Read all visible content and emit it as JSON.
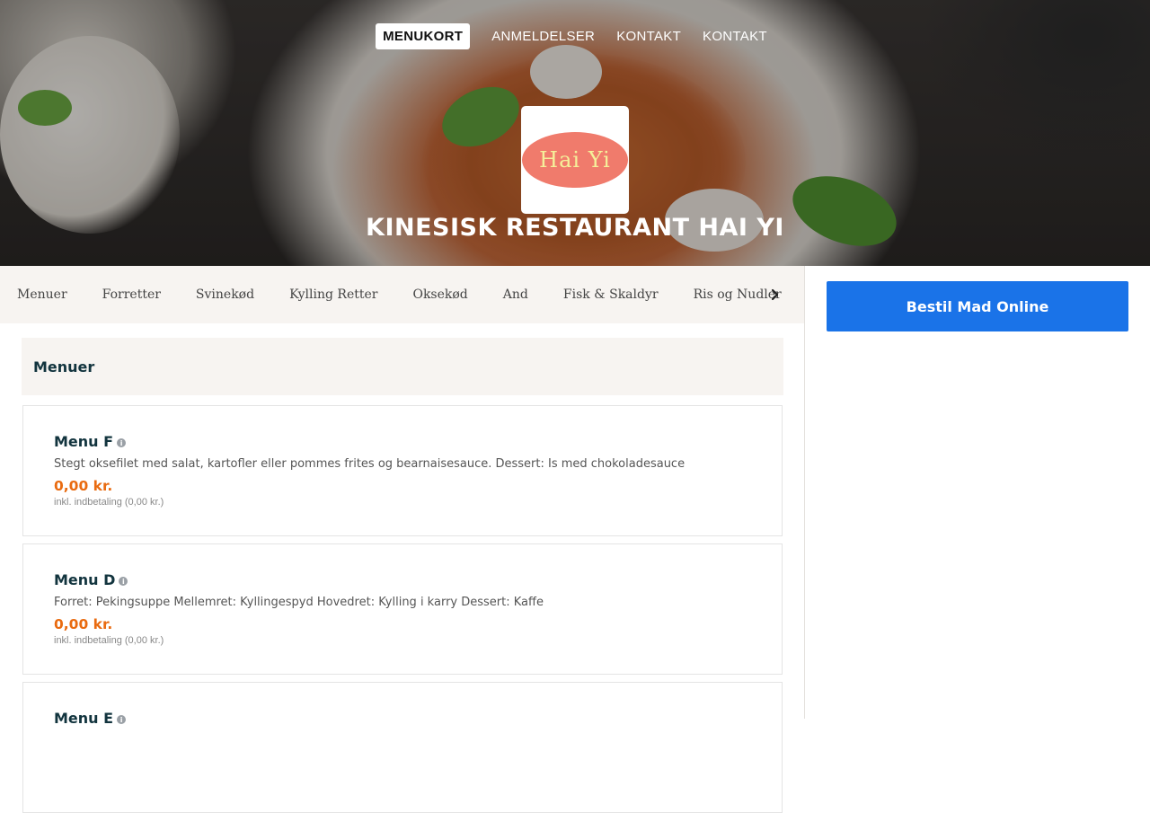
{
  "topnav": {
    "items": [
      {
        "label": "MENUKORT"
      },
      {
        "label": "ANMELDELSER"
      },
      {
        "label": "KONTAKT"
      },
      {
        "label": "KONTAKT"
      }
    ]
  },
  "hero": {
    "logo_text": "Hai Yi",
    "title": "KINESISK RESTAURANT HAI YI"
  },
  "categories": {
    "items": [
      "Menuer",
      "Forretter",
      "Svinekød",
      "Kylling Retter",
      "Oksekød",
      "And",
      "Fisk & Skaldyr",
      "Ris og Nudler"
    ],
    "next_icon": "chevron-right-icon"
  },
  "order_button": {
    "label": "Bestil Mad Online"
  },
  "section": {
    "title": "Menuer",
    "items": [
      {
        "name": "Menu F",
        "info_icon": "info-icon",
        "description": "Stegt oksefilet med salat, kartofler eller pommes frites og bearnaisesauce. Dessert: Is med chokoladesauce",
        "price": "0,00 kr.",
        "fee": "inkl. indbetaling (0,00 kr.)"
      },
      {
        "name": "Menu D",
        "info_icon": "info-icon",
        "description": "Forret: Pekingsuppe Mellemret: Kyllingespyd Hovedret: Kylling i karry Dessert: Kaffe",
        "price": "0,00 kr.",
        "fee": "inkl. indbetaling (0,00 kr.)"
      },
      {
        "name": "Menu E",
        "info_icon": "info-icon"
      }
    ]
  },
  "colors": {
    "accent_blue": "#1a73e8",
    "price_orange": "#e96b10",
    "heading_dark": "#12343e",
    "logo_oval": "#f07b6c",
    "logo_text": "#f5f09a"
  }
}
